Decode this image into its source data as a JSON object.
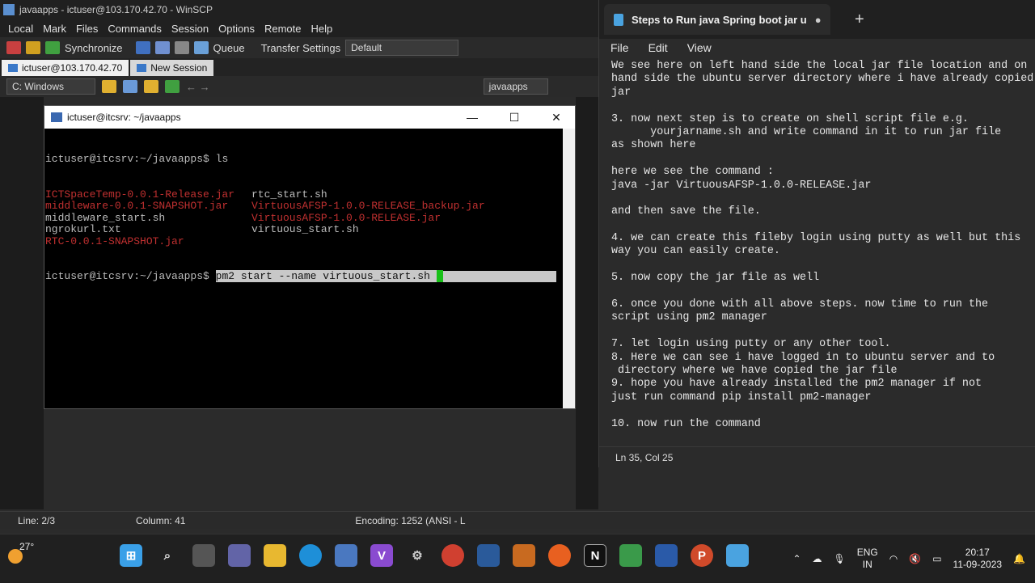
{
  "winscp": {
    "title": "javaapps - ictuser@103.170.42.70 - WinSCP",
    "menu": [
      "Local",
      "Mark",
      "Files",
      "Commands",
      "Session",
      "Options",
      "Remote",
      "Help"
    ],
    "toolbar": {
      "synchronize": "Synchronize",
      "queue": "Queue",
      "transfer_settings": "Transfer Settings",
      "transfer_value": "Default"
    },
    "tabs": [
      "ictuser@103.170.42.70",
      "New Session"
    ],
    "local_drive": "C: Windows",
    "remote_dir": "javaapps",
    "status": {
      "line": "Line: 2/3",
      "column": "Column: 41",
      "encoding": "Encoding: 1252  (ANSI - L"
    }
  },
  "putty": {
    "title": "ictuser@itcsrv: ~/javaapps",
    "prompt": "ictuser@itcsrv:~/javaapps$ ",
    "ls_cmd": "ls",
    "files_col1": [
      {
        "name": "ICTSpaceTemp-0.0.1-Release.jar",
        "color": "#c03030"
      },
      {
        "name": "middleware-0.0.1-SNAPSHOT.jar",
        "color": "#c03030"
      },
      {
        "name": "middleware_start.sh",
        "color": "#bbbbbb"
      },
      {
        "name": "ngrokurl.txt",
        "color": "#bbbbbb"
      },
      {
        "name": "RTC-0.0.1-SNAPSHOT.jar",
        "color": "#c03030"
      }
    ],
    "files_col2": [
      {
        "name": "rtc_start.sh",
        "color": "#bbbbbb"
      },
      {
        "name": "VirtuousAFSP-1.0.0-RELEASE_backup.jar",
        "color": "#c03030"
      },
      {
        "name": "VirtuousAFSP-1.0.0-RELEASE.jar",
        "color": "#c03030"
      },
      {
        "name": "virtuous_start.sh",
        "color": "#bbbbbb"
      }
    ],
    "current_cmd": "pm2 start --name virtuous_start.sh "
  },
  "notepad": {
    "tab_title": "Steps to Run java Spring boot jar u",
    "menu": [
      "File",
      "Edit",
      "View"
    ],
    "lines": [
      "We see here on left hand side the local jar file location and on r",
      "hand side the ubuntu server directory where i have already copied",
      "jar",
      "",
      "3. now next step is to create on shell script file e.g.",
      "      yourjarname.sh and write command in it to run jar file",
      "as shown here",
      "",
      "here we see the command :",
      "java -jar VirtuousAFSP-1.0.0-RELEASE.jar",
      "",
      "and then save the file.",
      "",
      "4. we can create this fileby login using putty as well but this",
      "way you can easily create.",
      "",
      "5. now copy the jar file as well",
      "",
      "6. once you done with all above steps. now time to run the",
      "script using pm2 manager",
      "",
      "7. let login using putty or any other tool.",
      "8. Here we can see i have logged in to ubuntu server and to",
      " directory where we have copied the jar file",
      "9. hope you have already installed the pm2 manager if not",
      "just run command pip install pm2-manager",
      "",
      "10. now run the command"
    ],
    "status": "Ln 35, Col 25"
  },
  "taskbar": {
    "weather": "27°",
    "lang_top": "ENG",
    "lang_bottom": "IN",
    "time": "20:17",
    "date": "11-09-2023"
  }
}
